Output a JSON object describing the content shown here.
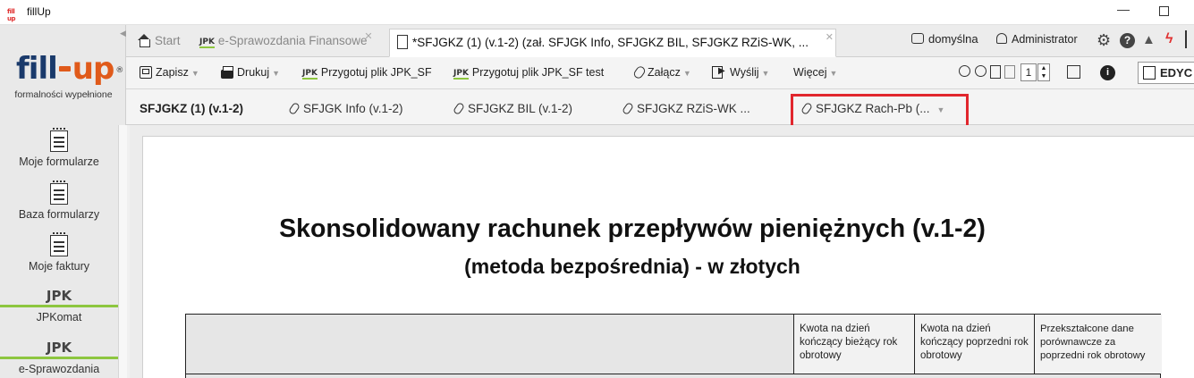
{
  "window": {
    "logo_text": "fill up",
    "title": "fillUp",
    "minimize": "—"
  },
  "sidebar": {
    "brand_left": "fill",
    "brand_right": "up",
    "brand_reg": "®",
    "tagline": "formalności wypełnione",
    "collapse_arrow": "◀",
    "items": [
      {
        "label": "Moje formularze",
        "icon": "form-icon"
      },
      {
        "label": "Baza formularzy",
        "icon": "form-icon"
      },
      {
        "label": "Moje faktury",
        "icon": "invoice-icon"
      },
      {
        "label": "JPKomat",
        "icon": "jpk-icon",
        "badge": "JPK"
      },
      {
        "label": "e-Sprawozdania",
        "icon": "jpk-icon",
        "badge": "JPK"
      }
    ]
  },
  "tabs": {
    "start": "Start",
    "esprawozdania": "e-Sprawozdania Finansowe",
    "jpk_badge": "JPK",
    "active": "*SFJGKZ (1) (v.1-2) (zał. SFJGK Info, SFJGKZ BIL, SFJGKZ RZiS-WK, ...",
    "close": "✕",
    "profile": "domyślna",
    "user": "Administrator"
  },
  "toolbar": {
    "save": "Zapisz",
    "print": "Drukuj",
    "prepare_jpk": "Przygotuj plik JPK_SF",
    "prepare_jpk_test": "Przygotuj plik JPK_SF test",
    "attach": "Załącz",
    "send": "Wyślij",
    "more": "Więcej",
    "page_number": "1",
    "edit": "EDYC",
    "dropdown_arrow": "▼",
    "separator": "|"
  },
  "subtabs": [
    {
      "label": "SFJGKZ (1) (v.1-2)"
    },
    {
      "label": "SFJGK Info (v.1-2)"
    },
    {
      "label": "SFJGKZ BIL (v.1-2)"
    },
    {
      "label": "SFJGKZ RZiS-WK ..."
    },
    {
      "label": "SFJGKZ Rach-Pb (...",
      "dropdown": "▼"
    }
  ],
  "document": {
    "title": "Skonsolidowany rachunek przepływów pieniężnych (v.1-2)",
    "subtitle": "(metoda bezpośrednia) - w złotych",
    "columns": [
      "Kwota na dzień kończący bieżący rok obrotowy",
      "Kwota na dzień kończący poprzedni rok obrotowy",
      "Przekształcone dane porównawcze za poprzedni rok obrotowy"
    ]
  },
  "colors": {
    "brand_blue": "#1a3a6b",
    "brand_orange": "#e05a1a",
    "jpk_green": "#8dc63f",
    "highlight_red": "#e1262d"
  }
}
